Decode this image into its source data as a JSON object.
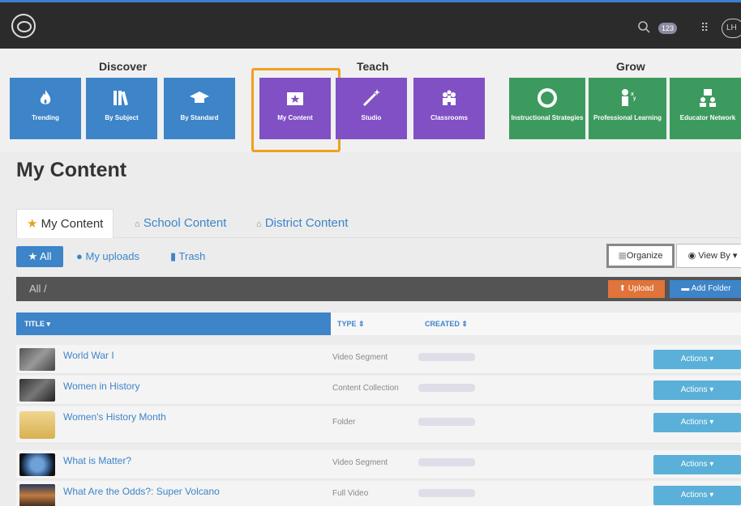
{
  "topbar": {
    "badge": "123",
    "avatar": "LH",
    "icons": [
      "logo-icon",
      "search-icon",
      "apps-grid-icon"
    ]
  },
  "nav": {
    "sections": [
      "Discover",
      "Teach",
      "Grow"
    ],
    "tiles": [
      {
        "label": "Trending",
        "icon": "flame-icon"
      },
      {
        "label": "By Subject",
        "icon": "books-icon"
      },
      {
        "label": "By Standard",
        "icon": "graduation-cap-icon"
      },
      {
        "label": "My Content",
        "icon": "folder-star-icon"
      },
      {
        "label": "Studio",
        "icon": "magic-wand-icon"
      },
      {
        "label": "Classrooms",
        "icon": "people-icon"
      },
      {
        "label": "Instructional Strategies",
        "icon": "lifebuoy-icon"
      },
      {
        "label": "Professional Learning",
        "icon": "learner-icon"
      },
      {
        "label": "Educator Network",
        "icon": "network-icon"
      }
    ],
    "selected": "My Content"
  },
  "page": {
    "title": "My Content",
    "tabs": [
      "My Content",
      "School Content",
      "District Content"
    ],
    "filters": {
      "all": "All",
      "uploads": "My uploads",
      "trash": "Trash"
    },
    "organize": "Organize",
    "view_by": "View By",
    "breadcrumb": "All /",
    "upload": "Upload",
    "add_folder": "Add Folder"
  },
  "table": {
    "columns": [
      "TITLE",
      "TYPE",
      "CREATED"
    ],
    "rows": [
      {
        "title": "World War I",
        "type": "Video Segment",
        "actions": "Actions ▾"
      },
      {
        "title": "Women in History",
        "type": "Content Collection",
        "actions": "Actions ▾"
      },
      {
        "title": "Women's History Month",
        "type": "Folder",
        "actions": "Actions ▾"
      },
      {
        "title": "What is Matter?",
        "type": "Video Segment",
        "actions": "Actions ▾"
      },
      {
        "title": "What Are the Odds?: Super Volcano",
        "type": "Full Video",
        "actions": "Actions ▾"
      }
    ]
  },
  "colors": {
    "discover": "#3d84c8",
    "teach": "#8150c4",
    "grow": "#3d9a5e",
    "highlight": "#f0a020",
    "upload": "#e0743a",
    "actions": "#5ab0d8"
  }
}
